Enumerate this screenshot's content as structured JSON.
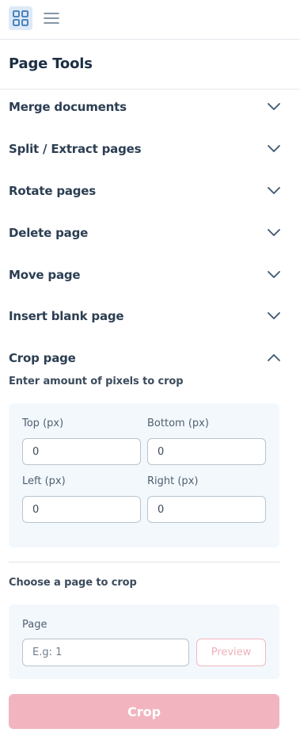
{
  "toolbar": {
    "grid_view_icon": "grid-icon",
    "list_view_icon": "list-icon"
  },
  "panel": {
    "title": "Page Tools"
  },
  "tools": [
    {
      "label": "Merge documents",
      "state": "collapsed"
    },
    {
      "label": "Split / Extract pages",
      "state": "collapsed"
    },
    {
      "label": "Rotate pages",
      "state": "collapsed"
    },
    {
      "label": "Delete page",
      "state": "collapsed"
    },
    {
      "label": "Move page",
      "state": "collapsed"
    },
    {
      "label": "Insert blank page",
      "state": "collapsed"
    },
    {
      "label": "Crop page",
      "state": "expanded"
    }
  ],
  "crop": {
    "hint": "Enter amount of pixels to crop",
    "top_label": "Top (px)",
    "top_value": "0",
    "bottom_label": "Bottom (px)",
    "bottom_value": "0",
    "left_label": "Left (px)",
    "left_value": "0",
    "right_label": "Right (px)",
    "right_value": "0",
    "choose_label": "Choose a page to crop",
    "page_label": "Page",
    "page_placeholder": "E.g: 1",
    "preview_label": "Preview",
    "crop_label": "Crop"
  },
  "colors": {
    "accent_pink": "#f2b5bf",
    "active_view_bg": "#dde9f6",
    "icon_blue": "#3a78b7",
    "card_bg": "#f3f8fd"
  }
}
